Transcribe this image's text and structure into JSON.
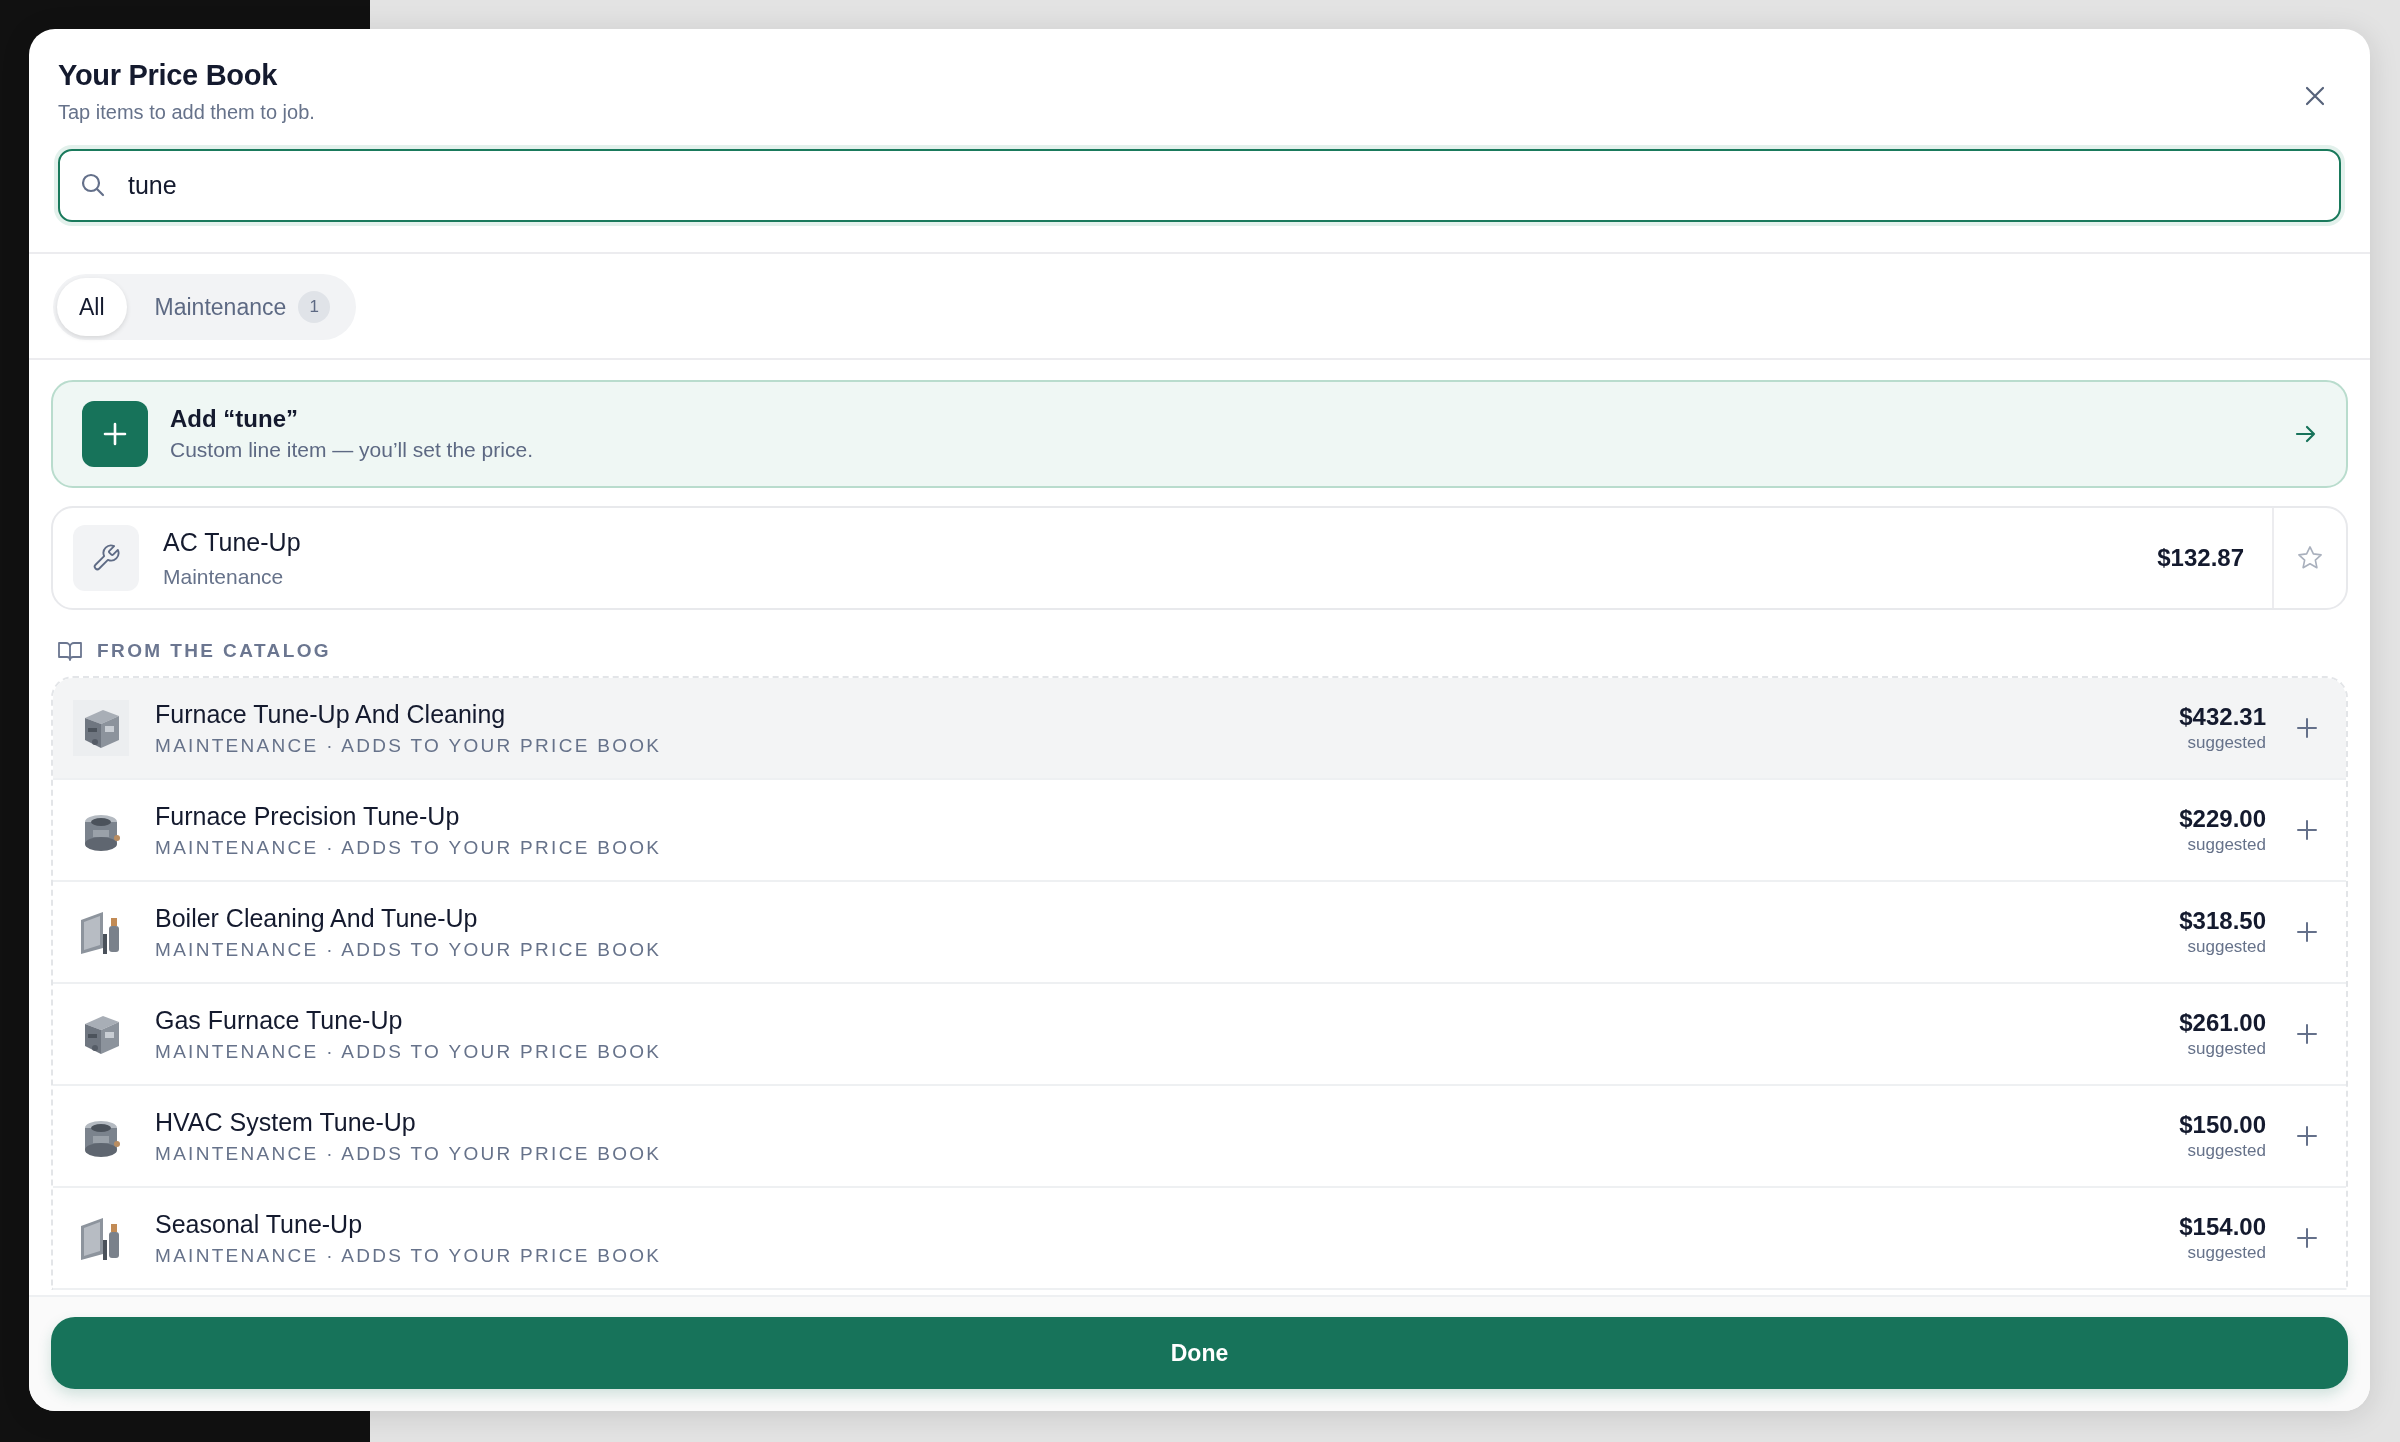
{
  "dialog": {
    "title": "Your Price Book",
    "subtitle": "Tap items to add them to job.",
    "search": {
      "value": "tune"
    },
    "filters": [
      {
        "label": "All",
        "selected": true
      },
      {
        "label": "Maintenance",
        "count": "1",
        "selected": false
      }
    ],
    "add_custom": {
      "title": "Add “tune”",
      "subtitle": "Custom line item — you’ll set the price."
    },
    "saved_items": [
      {
        "name": "AC Tune-Up",
        "category": "Maintenance",
        "price": "$132.87",
        "favorite": false
      }
    ],
    "catalog_heading": "FROM THE CATALOG",
    "catalog_items": [
      {
        "name": "Furnace Tune-Up And Cleaning",
        "meta": "MAINTENANCE · ADDS TO YOUR PRICE BOOK",
        "price": "$432.31",
        "note": "suggested",
        "highlighted": true
      },
      {
        "name": "Furnace Precision Tune-Up",
        "meta": "MAINTENANCE · ADDS TO YOUR PRICE BOOK",
        "price": "$229.00",
        "note": "suggested",
        "highlighted": false
      },
      {
        "name": "Boiler Cleaning And Tune-Up",
        "meta": "MAINTENANCE · ADDS TO YOUR PRICE BOOK",
        "price": "$318.50",
        "note": "suggested",
        "highlighted": false
      },
      {
        "name": "Gas Furnace Tune-Up",
        "meta": "MAINTENANCE · ADDS TO YOUR PRICE BOOK",
        "price": "$261.00",
        "note": "suggested",
        "highlighted": false
      },
      {
        "name": "HVAC System Tune-Up",
        "meta": "MAINTENANCE · ADDS TO YOUR PRICE BOOK",
        "price": "$150.00",
        "note": "suggested",
        "highlighted": false
      },
      {
        "name": "Seasonal Tune-Up",
        "meta": "MAINTENANCE · ADDS TO YOUR PRICE BOOK",
        "price": "$154.00",
        "note": "suggested",
        "highlighted": false
      }
    ],
    "done_button": "Done"
  }
}
